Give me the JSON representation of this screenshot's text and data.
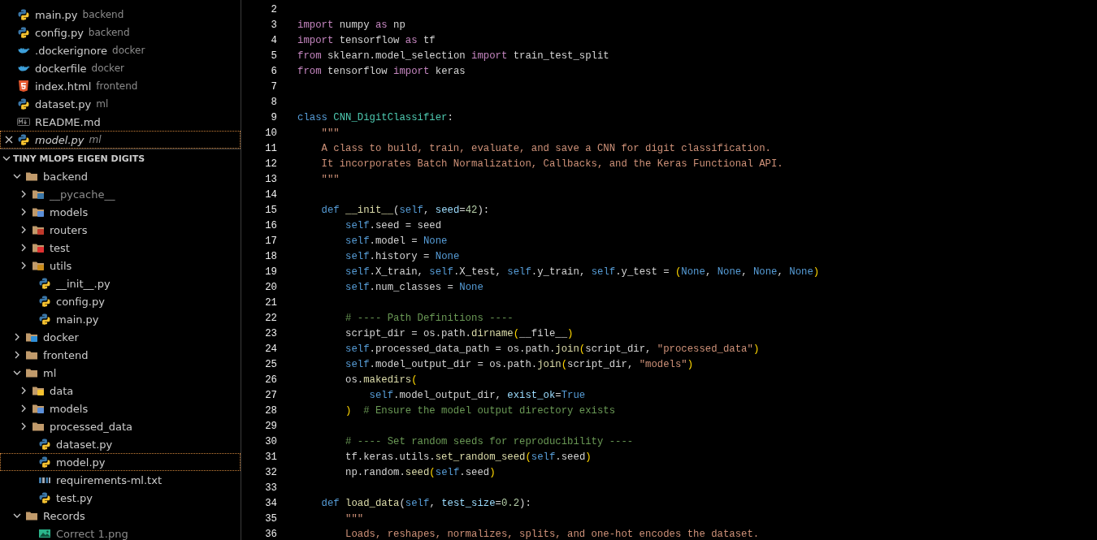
{
  "open_editors": [
    {
      "name": "main.py",
      "description": "backend",
      "kind": "python",
      "selected": false,
      "preview": false
    },
    {
      "name": "config.py",
      "description": "backend",
      "kind": "python",
      "selected": false,
      "preview": false
    },
    {
      "name": ".dockerignore",
      "description": "docker",
      "kind": "docker",
      "selected": false,
      "preview": false
    },
    {
      "name": "dockerfile",
      "description": "docker",
      "kind": "docker",
      "selected": false,
      "preview": false
    },
    {
      "name": "index.html",
      "description": "frontend",
      "kind": "html",
      "selected": false,
      "preview": false
    },
    {
      "name": "dataset.py",
      "description": "ml",
      "kind": "python",
      "selected": false,
      "preview": false
    },
    {
      "name": "README.md",
      "kind": "markdown",
      "selected": false,
      "preview": false
    },
    {
      "name": "model.py",
      "description": "ml",
      "kind": "python",
      "selected": true,
      "preview": true
    }
  ],
  "explorer": {
    "title": "TINY MLOPS EIGEN DIGITS",
    "expanded": true,
    "items": [
      {
        "name": "backend",
        "kind": "folder",
        "expanded": true,
        "selected": false,
        "ignored": false,
        "children": [
          {
            "name": "__pycache__",
            "kind": "folder-python",
            "expanded": false,
            "selected": false,
            "ignored": true
          },
          {
            "name": "models",
            "kind": "folder-models",
            "expanded": false,
            "selected": false,
            "ignored": false
          },
          {
            "name": "routers",
            "kind": "folder-routers",
            "expanded": false,
            "selected": false,
            "ignored": false
          },
          {
            "name": "test",
            "kind": "folder-test",
            "expanded": false,
            "selected": false,
            "ignored": false
          },
          {
            "name": "utils",
            "kind": "folder-utils",
            "expanded": false,
            "selected": false,
            "ignored": false
          },
          {
            "name": "__init__.py",
            "kind": "python",
            "selected": false,
            "ignored": false
          },
          {
            "name": "config.py",
            "kind": "python",
            "selected": false,
            "ignored": false
          },
          {
            "name": "main.py",
            "kind": "python",
            "selected": false,
            "ignored": false
          }
        ]
      },
      {
        "name": "docker",
        "kind": "folder-docker",
        "expanded": false,
        "selected": false,
        "ignored": false
      },
      {
        "name": "frontend",
        "kind": "folder",
        "expanded": false,
        "selected": false,
        "ignored": false
      },
      {
        "name": "ml",
        "kind": "folder",
        "expanded": true,
        "selected": false,
        "ignored": false,
        "children": [
          {
            "name": "data",
            "kind": "folder-data",
            "expanded": false,
            "selected": false,
            "ignored": false
          },
          {
            "name": "models",
            "kind": "folder-models",
            "expanded": false,
            "selected": false,
            "ignored": false
          },
          {
            "name": "processed_data",
            "kind": "folder",
            "expanded": false,
            "selected": false,
            "ignored": false
          },
          {
            "name": "dataset.py",
            "kind": "python",
            "selected": false,
            "ignored": false
          },
          {
            "name": "model.py",
            "kind": "python",
            "selected": true,
            "ignored": false
          },
          {
            "name": "requirements-ml.txt",
            "kind": "txt",
            "selected": false,
            "ignored": false
          },
          {
            "name": "test.py",
            "kind": "python",
            "selected": false,
            "ignored": false
          }
        ]
      },
      {
        "name": "Records",
        "kind": "folder",
        "expanded": true,
        "selected": false,
        "ignored": false,
        "children": [
          {
            "name": "Correct 1.png",
            "kind": "image",
            "selected": false,
            "ignored": true
          }
        ]
      }
    ]
  },
  "editor": {
    "lines": [
      {
        "number": "2"
      },
      {
        "number": "3",
        "tokens": [
          {
            "kind": "kw",
            "text": "import"
          },
          {
            "kind": "plain",
            "text": " numpy "
          },
          {
            "kind": "kw",
            "text": "as"
          },
          {
            "kind": "plain",
            "text": " np"
          }
        ]
      },
      {
        "number": "4",
        "tokens": [
          {
            "kind": "kw",
            "text": "import"
          },
          {
            "kind": "plain",
            "text": " tensorflow "
          },
          {
            "kind": "kw",
            "text": "as"
          },
          {
            "kind": "plain",
            "text": " tf"
          }
        ]
      },
      {
        "number": "5",
        "tokens": [
          {
            "kind": "kw",
            "text": "from"
          },
          {
            "kind": "plain",
            "text": " sklearn.model_selection "
          },
          {
            "kind": "kw",
            "text": "import"
          },
          {
            "kind": "plain",
            "text": " train_test_split"
          }
        ]
      },
      {
        "number": "6",
        "tokens": [
          {
            "kind": "kw",
            "text": "from"
          },
          {
            "kind": "plain",
            "text": " tensorflow "
          },
          {
            "kind": "kw",
            "text": "import"
          },
          {
            "kind": "plain",
            "text": " keras"
          }
        ]
      },
      {
        "number": "7"
      },
      {
        "number": "8"
      },
      {
        "number": "9",
        "tokens": [
          {
            "kind": "decl",
            "text": "class"
          },
          {
            "kind": "type",
            "text": " CNN_DigitClassifier"
          },
          {
            "kind": "plain",
            "text": ":"
          }
        ]
      },
      {
        "number": "10",
        "tokens": [
          {
            "kind": "str",
            "text": "    \"\"\""
          }
        ]
      },
      {
        "number": "11",
        "tokens": [
          {
            "kind": "str",
            "text": "    A class to build, train, evaluate, and save a CNN for digit classification."
          }
        ]
      },
      {
        "number": "12",
        "tokens": [
          {
            "kind": "str",
            "text": "    It incorporates Batch Normalization, Callbacks, and the Keras Functional API."
          }
        ]
      },
      {
        "number": "13",
        "tokens": [
          {
            "kind": "str",
            "text": "    \"\"\""
          }
        ]
      },
      {
        "number": "14"
      },
      {
        "number": "15",
        "tokens": [
          {
            "kind": "decl",
            "text": "    def"
          },
          {
            "kind": "func",
            "text": " __init__"
          },
          {
            "kind": "plain",
            "text": "("
          },
          {
            "kind": "decl",
            "text": "self"
          },
          {
            "kind": "plain",
            "text": ", "
          },
          {
            "kind": "param",
            "text": "seed"
          },
          {
            "kind": "plain",
            "text": "="
          },
          {
            "kind": "num",
            "text": "42"
          },
          {
            "kind": "plain",
            "text": "):"
          }
        ]
      },
      {
        "number": "16",
        "tokens": [
          {
            "kind": "decl",
            "text": "        self"
          },
          {
            "kind": "plain",
            "text": ".seed = seed"
          }
        ]
      },
      {
        "number": "17",
        "tokens": [
          {
            "kind": "decl",
            "text": "        self"
          },
          {
            "kind": "plain",
            "text": ".model = "
          },
          {
            "kind": "decl",
            "text": "None"
          }
        ]
      },
      {
        "number": "18",
        "tokens": [
          {
            "kind": "decl",
            "text": "        self"
          },
          {
            "kind": "plain",
            "text": ".history = "
          },
          {
            "kind": "decl",
            "text": "None"
          }
        ]
      },
      {
        "number": "19",
        "tokens": [
          {
            "kind": "decl",
            "text": "        self"
          },
          {
            "kind": "plain",
            "text": ".X_train, "
          },
          {
            "kind": "decl",
            "text": "self"
          },
          {
            "kind": "plain",
            "text": ".X_test, "
          },
          {
            "kind": "decl",
            "text": "self"
          },
          {
            "kind": "plain",
            "text": ".y_train, "
          },
          {
            "kind": "decl",
            "text": "self"
          },
          {
            "kind": "plain",
            "text": ".y_test = "
          },
          {
            "kind": "paren",
            "text": "("
          },
          {
            "kind": "decl",
            "text": "None"
          },
          {
            "kind": "plain",
            "text": ", "
          },
          {
            "kind": "decl",
            "text": "None"
          },
          {
            "kind": "plain",
            "text": ", "
          },
          {
            "kind": "decl",
            "text": "None"
          },
          {
            "kind": "plain",
            "text": ", "
          },
          {
            "kind": "decl",
            "text": "None"
          },
          {
            "kind": "paren",
            "text": ")"
          }
        ]
      },
      {
        "number": "20",
        "tokens": [
          {
            "kind": "decl",
            "text": "        self"
          },
          {
            "kind": "plain",
            "text": ".num_classes = "
          },
          {
            "kind": "decl",
            "text": "None"
          }
        ]
      },
      {
        "number": "21"
      },
      {
        "number": "22",
        "tokens": [
          {
            "kind": "comment",
            "text": "        # ---- Path Definitions ----"
          }
        ]
      },
      {
        "number": "23",
        "tokens": [
          {
            "kind": "plain",
            "text": "        script_dir = os.path."
          },
          {
            "kind": "func",
            "text": "dirname"
          },
          {
            "kind": "paren",
            "text": "("
          },
          {
            "kind": "plain",
            "text": "__file__"
          },
          {
            "kind": "paren",
            "text": ")"
          }
        ]
      },
      {
        "number": "24",
        "tokens": [
          {
            "kind": "decl",
            "text": "        self"
          },
          {
            "kind": "plain",
            "text": ".processed_data_path = os.path."
          },
          {
            "kind": "func",
            "text": "join"
          },
          {
            "kind": "paren",
            "text": "("
          },
          {
            "kind": "plain",
            "text": "script_dir, "
          },
          {
            "kind": "str",
            "text": "\"processed_data\""
          },
          {
            "kind": "paren",
            "text": ")"
          }
        ]
      },
      {
        "number": "25",
        "tokens": [
          {
            "kind": "decl",
            "text": "        self"
          },
          {
            "kind": "plain",
            "text": ".model_output_dir = os.path."
          },
          {
            "kind": "func",
            "text": "join"
          },
          {
            "kind": "paren",
            "text": "("
          },
          {
            "kind": "plain",
            "text": "script_dir, "
          },
          {
            "kind": "str",
            "text": "\"models\""
          },
          {
            "kind": "paren",
            "text": ")"
          }
        ]
      },
      {
        "number": "26",
        "tokens": [
          {
            "kind": "plain",
            "text": "        os."
          },
          {
            "kind": "func",
            "text": "makedirs"
          },
          {
            "kind": "paren",
            "text": "("
          }
        ]
      },
      {
        "number": "27",
        "tokens": [
          {
            "kind": "decl",
            "text": "            self"
          },
          {
            "kind": "plain",
            "text": ".model_output_dir, "
          },
          {
            "kind": "param",
            "text": "exist_ok"
          },
          {
            "kind": "plain",
            "text": "="
          },
          {
            "kind": "decl",
            "text": "True"
          }
        ]
      },
      {
        "number": "28",
        "tokens": [
          {
            "kind": "paren",
            "text": "        )"
          },
          {
            "kind": "comment",
            "text": "  # Ensure the model output directory exists"
          }
        ]
      },
      {
        "number": "29"
      },
      {
        "number": "30",
        "tokens": [
          {
            "kind": "comment",
            "text": "        # ---- Set random seeds for reproducibility ----"
          }
        ]
      },
      {
        "number": "31",
        "tokens": [
          {
            "kind": "plain",
            "text": "        tf.keras.utils."
          },
          {
            "kind": "func",
            "text": "set_random_seed"
          },
          {
            "kind": "paren",
            "text": "("
          },
          {
            "kind": "decl",
            "text": "self"
          },
          {
            "kind": "plain",
            "text": ".seed"
          },
          {
            "kind": "paren",
            "text": ")"
          }
        ]
      },
      {
        "number": "32",
        "tokens": [
          {
            "kind": "plain",
            "text": "        np.random."
          },
          {
            "kind": "func",
            "text": "seed"
          },
          {
            "kind": "paren",
            "text": "("
          },
          {
            "kind": "decl",
            "text": "self"
          },
          {
            "kind": "plain",
            "text": ".seed"
          },
          {
            "kind": "paren",
            "text": ")"
          }
        ]
      },
      {
        "number": "33"
      },
      {
        "number": "34",
        "tokens": [
          {
            "kind": "decl",
            "text": "    def"
          },
          {
            "kind": "func",
            "text": " load_data"
          },
          {
            "kind": "plain",
            "text": "("
          },
          {
            "kind": "decl",
            "text": "self"
          },
          {
            "kind": "plain",
            "text": ", "
          },
          {
            "kind": "param",
            "text": "test_size"
          },
          {
            "kind": "plain",
            "text": "="
          },
          {
            "kind": "num",
            "text": "0.2"
          },
          {
            "kind": "plain",
            "text": "):"
          }
        ]
      },
      {
        "number": "35",
        "tokens": [
          {
            "kind": "str",
            "text": "        \"\"\""
          }
        ]
      },
      {
        "number": "36",
        "tokens": [
          {
            "kind": "str",
            "text": "        Loads, reshapes, normalizes, splits, and one-hot encodes the dataset."
          }
        ]
      }
    ]
  }
}
